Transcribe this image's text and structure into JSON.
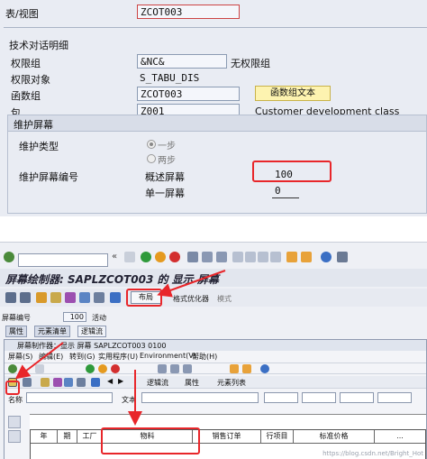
{
  "top": {
    "row_table_view_label": "表/视图",
    "row_table_view_value": "ZCOT003",
    "section_title": "技术对话明细",
    "auth_group_label": "权限组",
    "auth_group_value": "&NC&",
    "auth_group_text": "无权限组",
    "auth_object_label": "权限对象",
    "auth_object_value": "S_TABU_DIS",
    "function_group_label": "函数组",
    "function_group_value": "ZCOT003",
    "function_group_text_button": "函数组文本",
    "package_label": "包",
    "package_value": "Z001",
    "package_text": "Customer development class",
    "maint_screen_title": "维护屏幕",
    "maint_type_label": "维护类型",
    "radio_one_step": "一步",
    "radio_two_step": "两步",
    "maint_screen_no_label": "维护屏幕编号",
    "overview_screen_label": "概述屏幕",
    "overview_screen_value": "100",
    "single_screen_label": "单一屏幕",
    "single_screen_value": "0"
  },
  "bottom": {
    "painter_title": "屏幕绘制器: SAPLZCOT003 的 显示 屏幕",
    "layout_button": "布局",
    "format_optimizer": "格式优化器",
    "mode_label": "模式",
    "screen_number_label": "屏幕编号",
    "screen_number_value": "100",
    "screen_status": "活动",
    "tabs": [
      "属性",
      "元素清单",
      "逻辑流"
    ],
    "inner_title": "屏幕制作器：显示 屏幕 SAPLZCOT003 0100",
    "inner_menu": [
      "屏幕(S)",
      "编辑(E)",
      "转到(G)",
      "实用程序(U)",
      "Environment(V)",
      "帮助(H)"
    ],
    "inner_tb_items": [
      "逻辑流",
      "属性",
      "元素列表"
    ],
    "name_label": "名称",
    "text_label": "文本",
    "columns": [
      "年",
      "期",
      "工厂",
      "物料",
      "销售订单",
      "行项目",
      "标准价格",
      "..."
    ],
    "watermark": "https://blog.csdn.net/Bright_Hot"
  },
  "colors": {
    "highlight": "#e8262a",
    "button_yellow": "#fdf3b0",
    "panel_bg": "#e9ecf3"
  }
}
